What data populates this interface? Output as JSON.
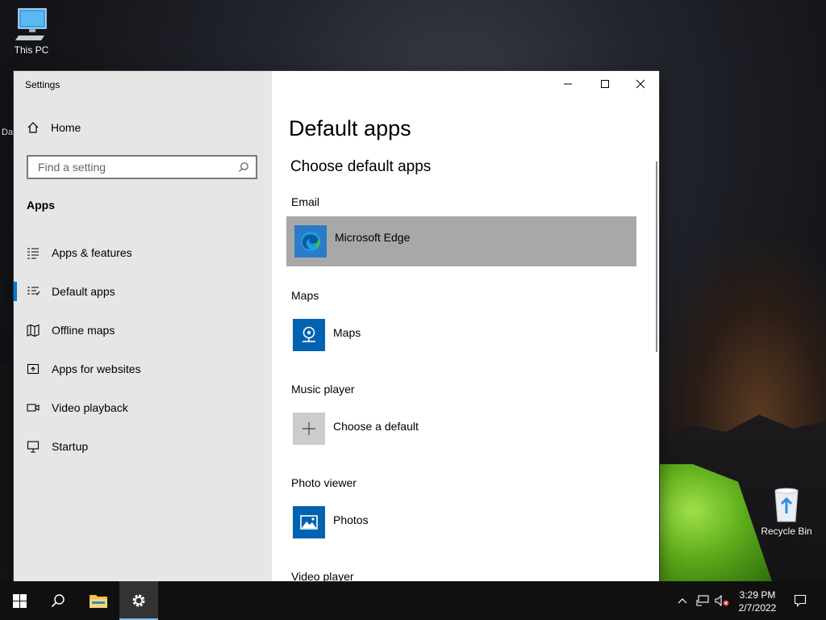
{
  "desktop": {
    "this_pc_label": "This PC",
    "recycle_bin_label": "Recycle Bin",
    "cut_label": "Da"
  },
  "window": {
    "title": "Settings",
    "controls": {
      "minimize": "minimize-icon",
      "maximize": "maximize-icon",
      "close": "close-icon"
    }
  },
  "sidebar": {
    "home_label": "Home",
    "search_placeholder": "Find a setting",
    "section": "Apps",
    "items": [
      {
        "label": "Apps & features",
        "icon": "list-icon"
      },
      {
        "label": "Default apps",
        "icon": "default-apps-icon",
        "active": true
      },
      {
        "label": "Offline maps",
        "icon": "map-icon"
      },
      {
        "label": "Apps for websites",
        "icon": "open-in-app-icon"
      },
      {
        "label": "Video playback",
        "icon": "video-icon"
      },
      {
        "label": "Startup",
        "icon": "startup-icon"
      }
    ]
  },
  "content": {
    "title": "Default apps",
    "subtitle": "Choose default apps",
    "defaults": [
      {
        "category": "Email",
        "app": "Microsoft Edge",
        "icon": "edge-icon"
      },
      {
        "category": "Maps",
        "app": "Maps",
        "icon": "maps-icon"
      },
      {
        "category": "Music player",
        "app": "Choose a default",
        "icon": "plus-icon"
      },
      {
        "category": "Photo viewer",
        "app": "Photos",
        "icon": "photos-icon"
      },
      {
        "category": "Video player"
      }
    ]
  },
  "taskbar": {
    "time": "3:29 PM",
    "date": "2/7/2022"
  },
  "colors": {
    "accent": "#0078d7",
    "sidebar_bg": "#e6e6e6",
    "hover_row": "#a8a8a8",
    "taskbar_bg": "#101010"
  }
}
